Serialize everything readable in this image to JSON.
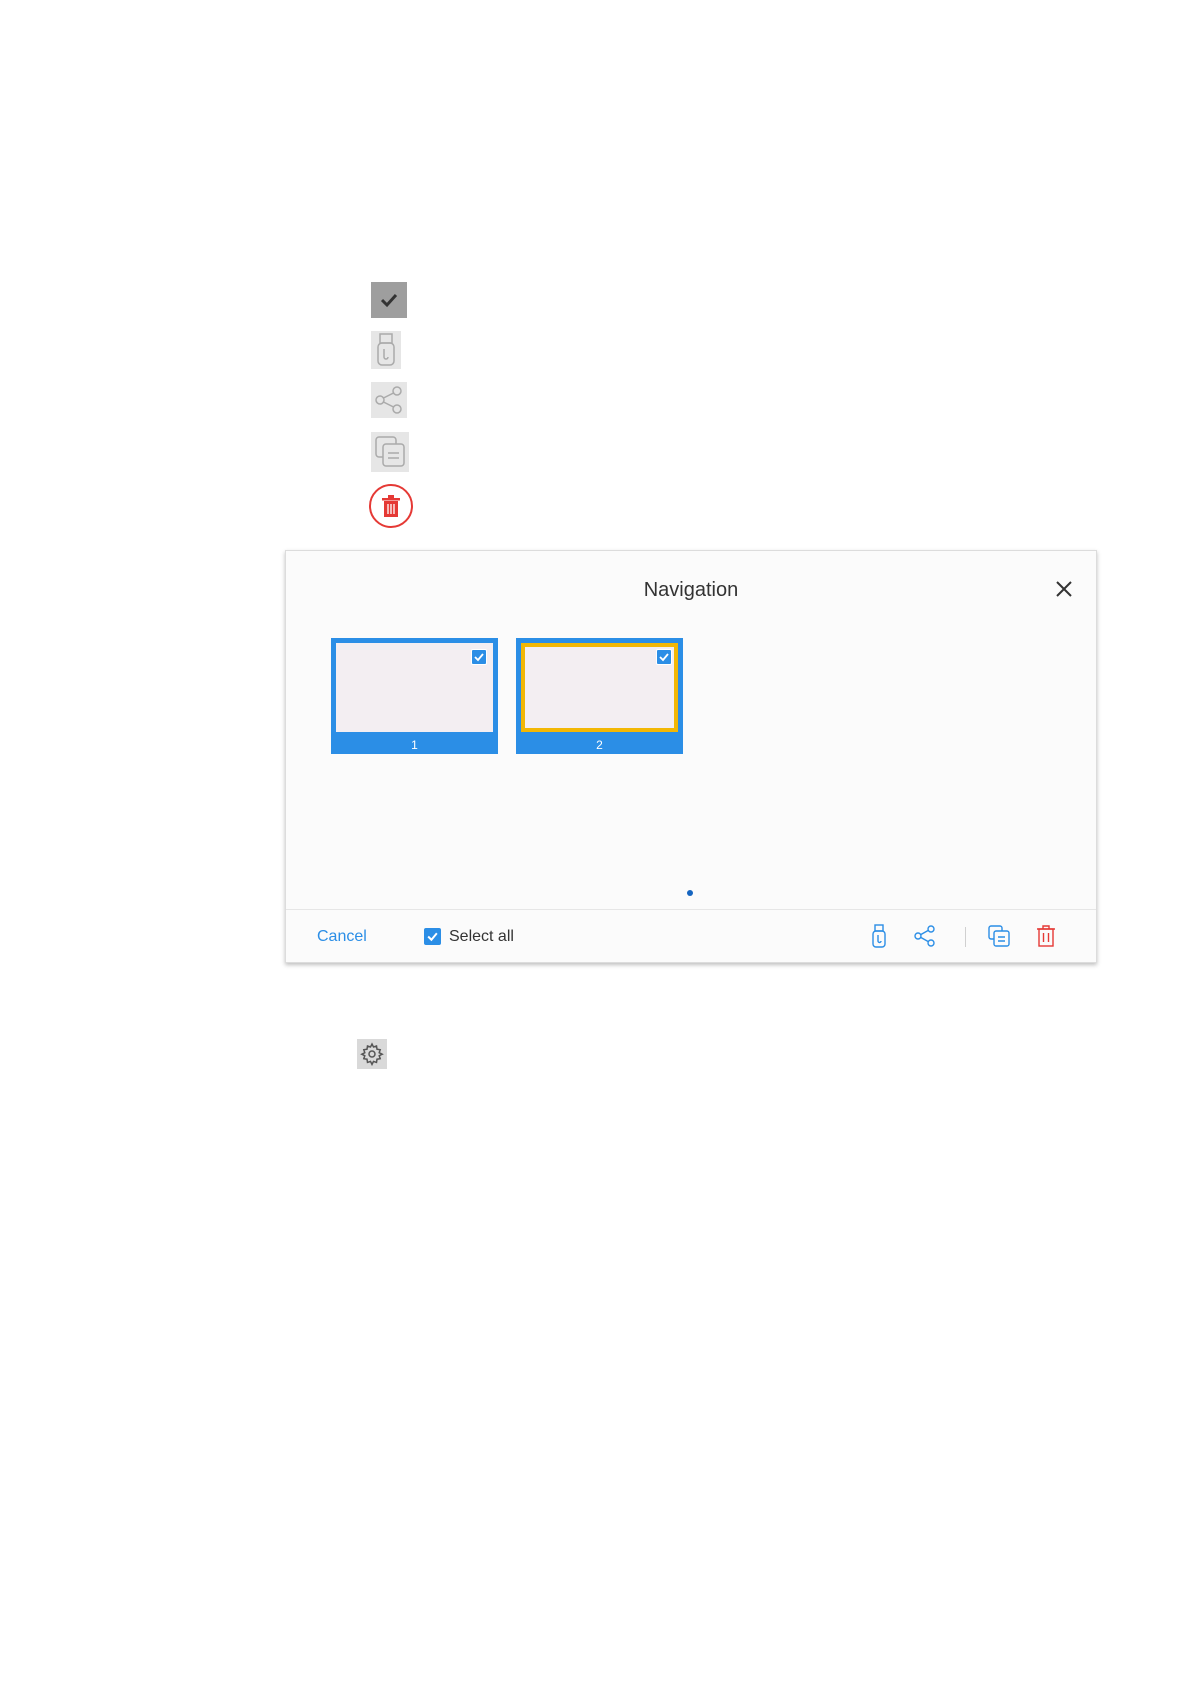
{
  "dialog": {
    "title": "Navigation",
    "pages": [
      {
        "number": "1",
        "selected": true,
        "current": false
      },
      {
        "number": "2",
        "selected": true,
        "current": true
      }
    ],
    "footer": {
      "cancel_label": "Cancel",
      "select_all_label": "Select all",
      "select_all_checked": true
    }
  },
  "colors": {
    "accent": "#2b8ee6",
    "current_page_border": "#f2b705",
    "delete": "#e53935"
  },
  "icons": [
    "check-icon",
    "usb-icon",
    "share-icon",
    "copy-icon",
    "trash-icon",
    "gear-icon",
    "close-icon"
  ]
}
